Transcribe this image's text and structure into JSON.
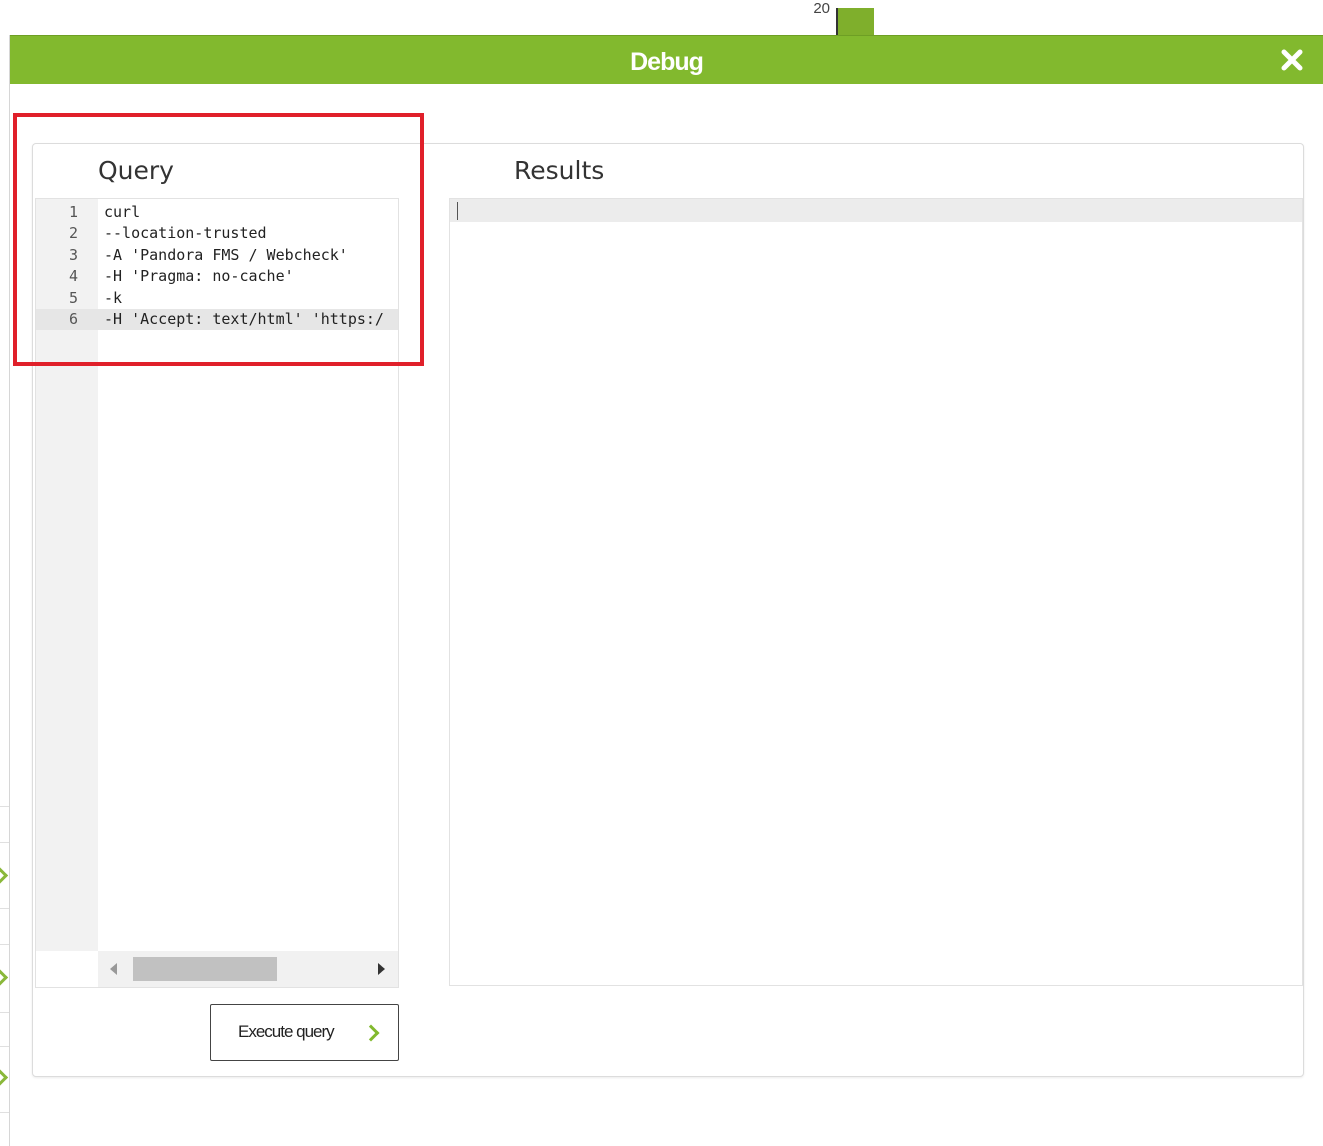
{
  "background": {
    "tick_label": "20",
    "accent_color": "#82b92e"
  },
  "dialog": {
    "title": "Debug",
    "close_icon": "close-icon",
    "titlebar_color": "#82b92e"
  },
  "query": {
    "label": "Query",
    "lines": [
      {
        "num": "1",
        "text": "curl"
      },
      {
        "num": "2",
        "text": "--location-trusted"
      },
      {
        "num": "3",
        "text": "-A 'Pandora FMS / Webcheck'"
      },
      {
        "num": "4",
        "text": "-H 'Pragma: no-cache'"
      },
      {
        "num": "5",
        "text": "-k"
      },
      {
        "num": "6",
        "text": "-H 'Accept: text/html' 'https:/"
      }
    ],
    "active_line": "6"
  },
  "results": {
    "label": "Results",
    "content": ""
  },
  "actions": {
    "execute_label": "Execute query",
    "execute_icon": "chevron-right-icon"
  },
  "annotation": {
    "highlight_color": "#e0202a"
  }
}
